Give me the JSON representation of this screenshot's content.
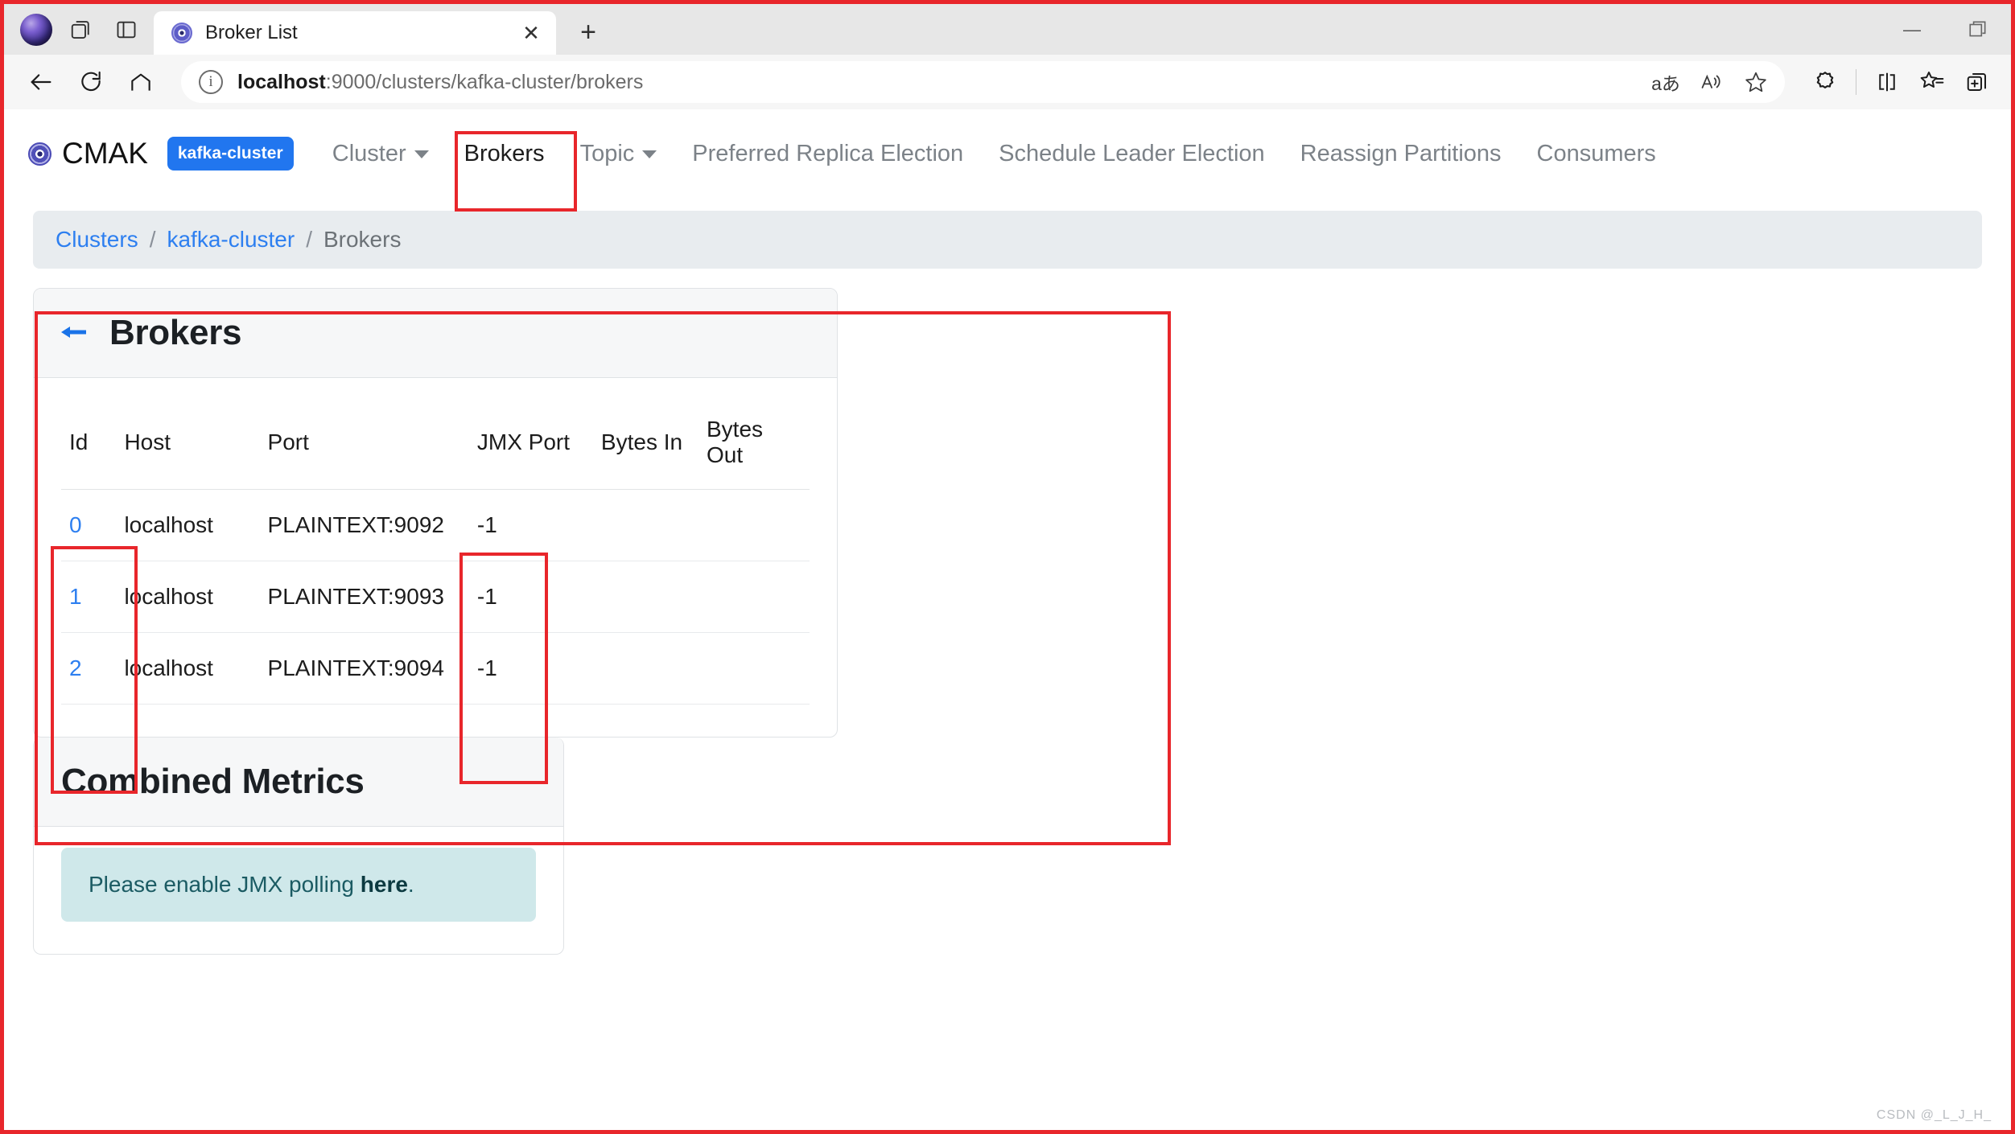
{
  "browser": {
    "tab": {
      "title": "Broker List",
      "favicon": "cmak-favicon",
      "close_label": "✕"
    },
    "new_tab_label": "+",
    "window_controls": {
      "minimize": "—",
      "maximize": "❐"
    },
    "toolbar": {
      "back_label": "←",
      "reload_label": "⟳",
      "home_label": "⌂",
      "url_host": "localhost",
      "url_rest": ":9000/clusters/kafka-cluster/brokers",
      "url_full": "localhost:9000/clusters/kafka-cluster/brokers",
      "info_icon_label": "i",
      "actions": [
        {
          "name": "translate-icon",
          "glyph": "aあ"
        },
        {
          "name": "read-aloud-icon",
          "glyph": "A⌒"
        },
        {
          "name": "favorite-star-icon",
          "glyph": "☆"
        }
      ],
      "right_actions": [
        {
          "name": "copilot-icon",
          "glyph": "✿"
        },
        {
          "name": "split-screen-icon",
          "glyph": "◫"
        },
        {
          "name": "favorites-list-icon",
          "glyph": "☆≡"
        },
        {
          "name": "collections-icon",
          "glyph": "⧉"
        }
      ]
    }
  },
  "app": {
    "brand": "CMAK",
    "cluster_badge": "kafka-cluster",
    "nav": [
      {
        "label": "Cluster",
        "has_caret": true,
        "active": false
      },
      {
        "label": "Brokers",
        "has_caret": false,
        "active": true
      },
      {
        "label": "Topic",
        "has_caret": true,
        "active": false
      },
      {
        "label": "Preferred Replica Election",
        "has_caret": false,
        "active": false
      },
      {
        "label": "Schedule Leader Election",
        "has_caret": false,
        "active": false
      },
      {
        "label": "Reassign Partitions",
        "has_caret": false,
        "active": false
      },
      {
        "label": "Consumers",
        "has_caret": false,
        "active": false
      }
    ],
    "breadcrumb": [
      {
        "label": "Clusters",
        "link": true
      },
      {
        "label": "/",
        "sep": true
      },
      {
        "label": "kafka-cluster",
        "link": true
      },
      {
        "label": "/",
        "sep": true
      },
      {
        "label": "Brokers",
        "link": false
      }
    ]
  },
  "brokers_card": {
    "back_arrow": "←",
    "title": "Brokers",
    "columns": [
      "Id",
      "Host",
      "Port",
      "JMX Port",
      "Bytes In",
      "Bytes Out"
    ],
    "rows": [
      {
        "id": "0",
        "host": "localhost",
        "port": "PLAINTEXT:9092",
        "jmx_port": "-1",
        "bytes_in": "",
        "bytes_out": ""
      },
      {
        "id": "1",
        "host": "localhost",
        "port": "PLAINTEXT:9093",
        "jmx_port": "-1",
        "bytes_in": "",
        "bytes_out": ""
      },
      {
        "id": "2",
        "host": "localhost",
        "port": "PLAINTEXT:9094",
        "jmx_port": "-1",
        "bytes_in": "",
        "bytes_out": ""
      }
    ]
  },
  "metrics_card": {
    "title": "Combined Metrics",
    "alert_prefix": "Please enable JMX polling ",
    "alert_link": "here",
    "alert_suffix": "."
  },
  "watermark": "CSDN @_L_J_H_",
  "colors": {
    "annotation": "#e8262b",
    "link": "#2d7ff0",
    "badge": "#2176ef",
    "alert_bg": "#cfe8ea",
    "breadcrumb_bg": "#e8ecef"
  }
}
